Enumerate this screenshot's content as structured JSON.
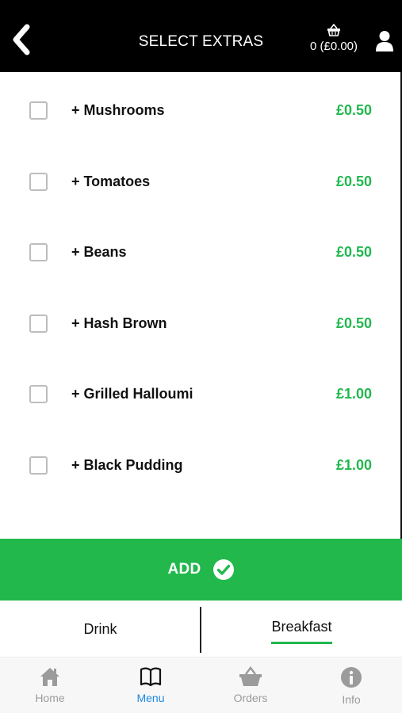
{
  "header": {
    "title": "SELECT EXTRAS",
    "cart_count": "0 (£0.00)",
    "back_icon": "chevron-left-icon",
    "cart_icon": "basket-icon",
    "user_icon": "user-icon"
  },
  "extras": [
    {
      "label": "+ Mushrooms",
      "price": "£0.50",
      "checked": false
    },
    {
      "label": "+ Tomatoes",
      "price": "£0.50",
      "checked": false
    },
    {
      "label": "+ Beans",
      "price": "£0.50",
      "checked": false
    },
    {
      "label": "+ Hash Brown",
      "price": "£0.50",
      "checked": false
    },
    {
      "label": "+ Grilled Halloumi",
      "price": "£1.00",
      "checked": false
    },
    {
      "label": "+ Black Pudding",
      "price": "£1.00",
      "checked": false
    }
  ],
  "add_button": {
    "label": "ADD",
    "icon": "check-circle-icon"
  },
  "categories": [
    {
      "label": "Drink",
      "active": false
    },
    {
      "label": "Breakfast",
      "active": true
    }
  ],
  "nav": [
    {
      "label": "Home",
      "icon": "home-icon",
      "active": false
    },
    {
      "label": "Menu",
      "icon": "book-icon",
      "active": true
    },
    {
      "label": "Orders",
      "icon": "basket-icon",
      "active": false
    },
    {
      "label": "Info",
      "icon": "info-icon",
      "active": false
    }
  ],
  "colors": {
    "header_bg": "#000000",
    "accent_green": "#22b84c",
    "active_nav": "#1e88e5",
    "inactive_nav": "#9b9b9b"
  }
}
